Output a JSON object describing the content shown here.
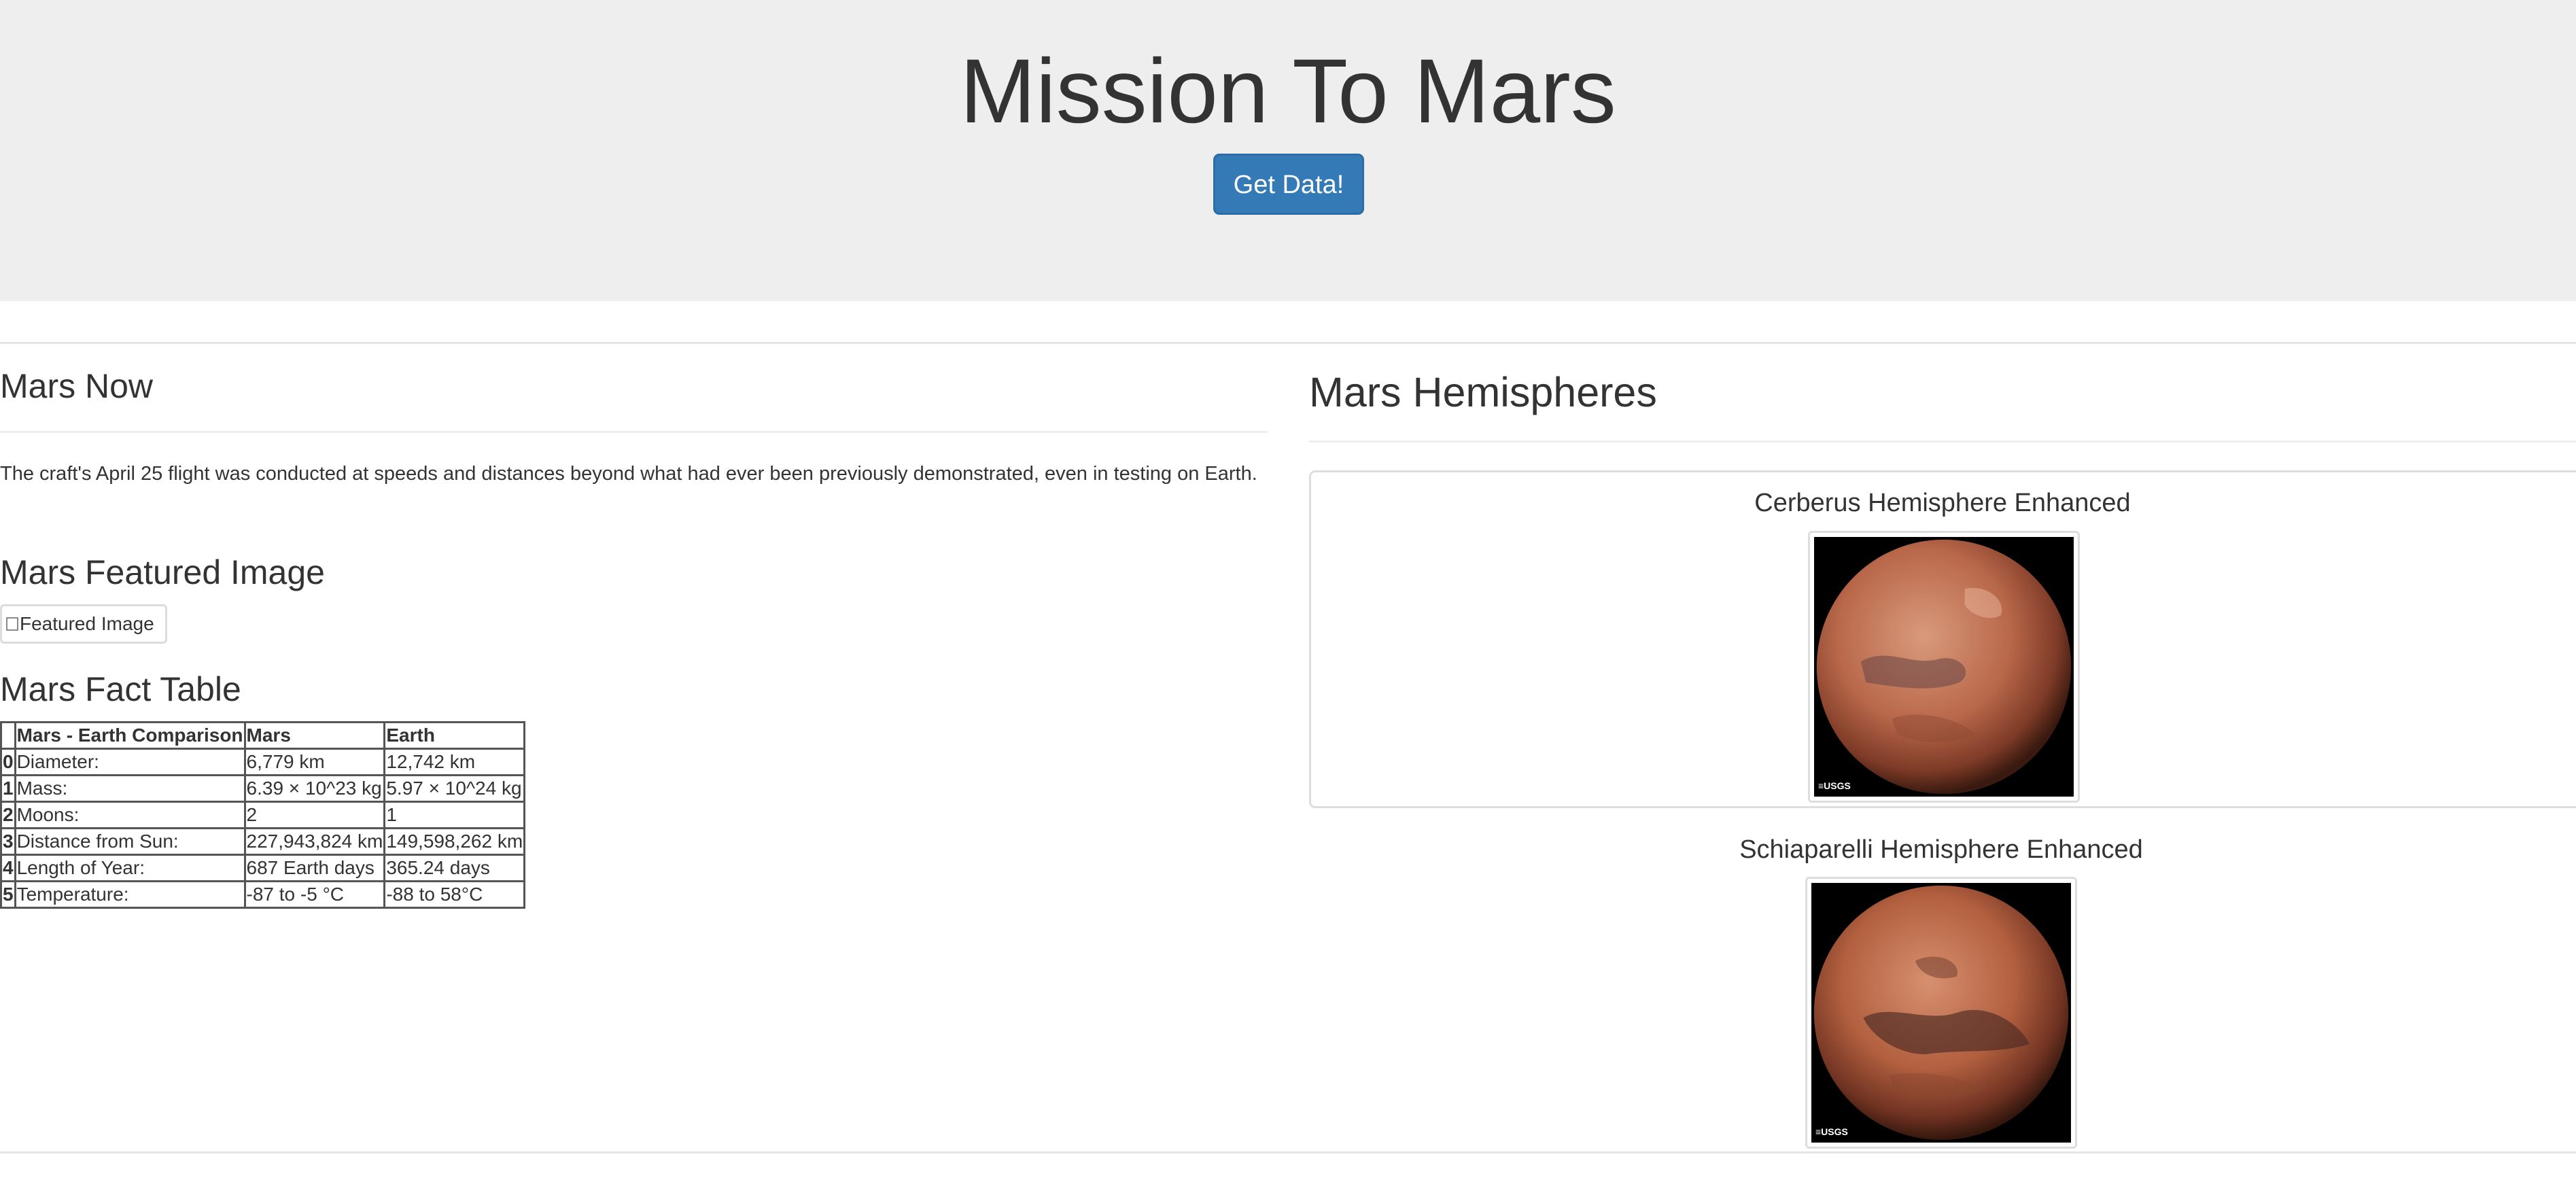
{
  "header": {
    "title": "Mission To Mars",
    "button_label": "Get Data!"
  },
  "news": {
    "section_title": "Mars Now",
    "paragraph": "The craft's April 25 flight was conducted at speeds and distances beyond what had ever been previously demonstrated, even in testing on Earth."
  },
  "featured": {
    "section_title": "Mars Featured Image",
    "image_alt": "Featured Image"
  },
  "facts": {
    "section_title": "Mars Fact Table",
    "headers": [
      "",
      "Mars - Earth Comparison",
      "Mars",
      "Earth"
    ],
    "rows": [
      {
        "index": "0",
        "label": "Diameter:",
        "mars": "6,779 km",
        "earth": "12,742 km"
      },
      {
        "index": "1",
        "label": "Mass:",
        "mars": "6.39 × 10^23 kg",
        "earth": "5.97 × 10^24 kg"
      },
      {
        "index": "2",
        "label": "Moons:",
        "mars": "2",
        "earth": "1"
      },
      {
        "index": "3",
        "label": "Distance from Sun:",
        "mars": "227,943,824 km",
        "earth": "149,598,262 km"
      },
      {
        "index": "4",
        "label": "Length of Year:",
        "mars": "687 Earth days",
        "earth": "365.24 days"
      },
      {
        "index": "5",
        "label": "Temperature:",
        "mars": "-87 to -5 °C",
        "earth": "-88 to 58°C"
      }
    ]
  },
  "hemispheres": {
    "section_title": "Mars Hemispheres",
    "items": [
      {
        "title": "Cerberus Hemisphere Enhanced",
        "logo_text": "≡USGS"
      },
      {
        "title": "Schiaparelli Hemisphere Enhanced",
        "logo_text": "≡USGS"
      }
    ]
  },
  "colors": {
    "jumbotron_bg": "#eeeeee",
    "button_bg": "#337ab7",
    "button_border": "#2e6da4",
    "text": "#333333",
    "mars_light": "#c9805e",
    "mars_dark": "#5a2a1c"
  }
}
